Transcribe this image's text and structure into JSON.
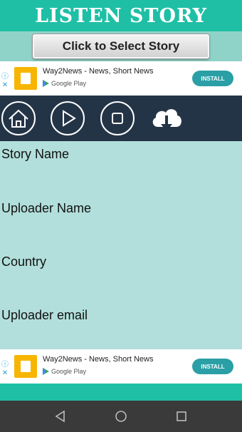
{
  "app": {
    "title": "LISTEN STORY"
  },
  "select_button": {
    "label": "Click to Select Story"
  },
  "ad_top": {
    "app_name": "Way2News - News, Short News",
    "store": "Google Play",
    "install": "INSTALL"
  },
  "ad_bottom": {
    "app_name": "Way2News - News, Short News",
    "store": "Google Play",
    "install": "INSTALL"
  },
  "toolbar": {
    "icons": [
      "home-icon",
      "play-icon",
      "stop-icon",
      "cloud-download-icon"
    ]
  },
  "fields": {
    "story_name": "Story Name",
    "uploader_name": "Uploader Name",
    "country": "Country",
    "uploader_email": "Uploader email"
  },
  "colors": {
    "header": "#1fbfa6",
    "content_bg": "#b2dfdb",
    "toolbar": "#243447",
    "navbar": "#3a3a3a",
    "install_button": "#2a9fa6"
  }
}
